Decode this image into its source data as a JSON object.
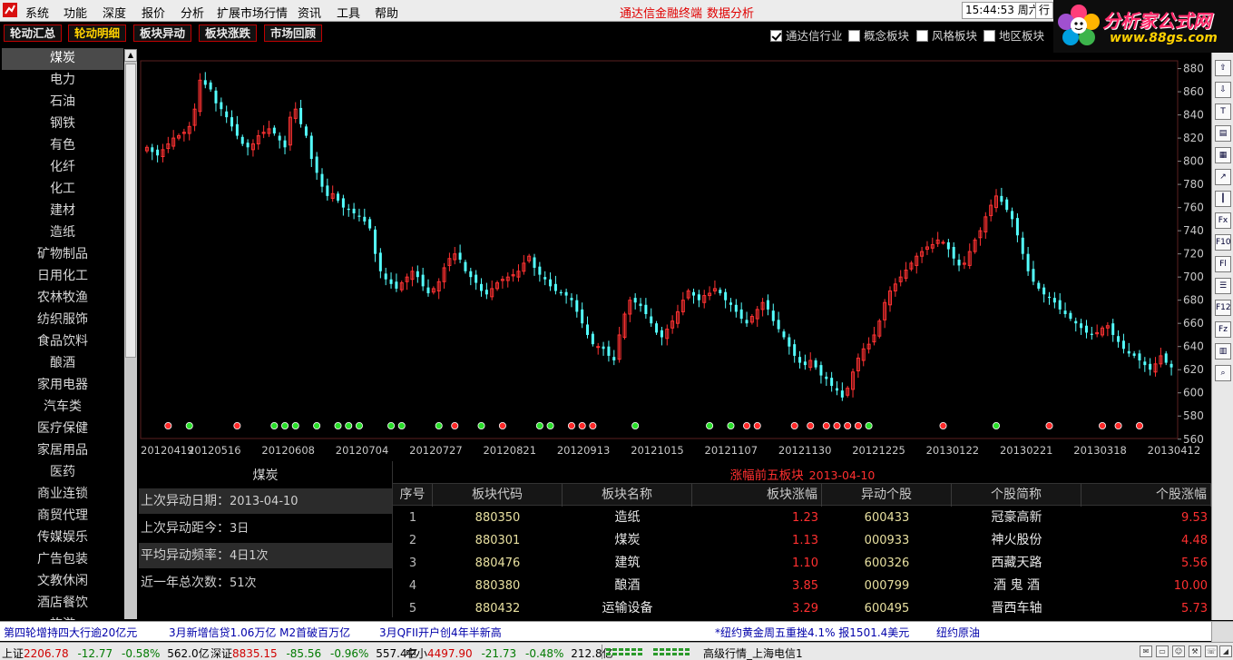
{
  "menu": {
    "items": [
      "系统",
      "功能",
      "深度",
      "报价",
      "分析",
      "扩展市场行情",
      "资讯",
      "工具",
      "帮助"
    ],
    "title_links": [
      "通达信金融终端",
      "数据分析"
    ],
    "clock": "15:44:53 周六",
    "extra": "行"
  },
  "logo": {
    "title": "分析家公式网",
    "url": "www.88gs.com"
  },
  "tabs": [
    {
      "label": "轮动汇总",
      "active": false
    },
    {
      "label": "轮动明细",
      "active": true
    },
    {
      "label": "板块异动",
      "active": false
    },
    {
      "label": "板块涨跌",
      "active": false
    },
    {
      "label": "市场回顾",
      "active": false
    }
  ],
  "filters": [
    {
      "label": "通达信行业",
      "checked": true
    },
    {
      "label": "概念板块",
      "checked": false
    },
    {
      "label": "风格板块",
      "checked": false
    },
    {
      "label": "地区板块",
      "checked": false
    }
  ],
  "sidebar": {
    "selected": "煤炭",
    "items": [
      "煤炭",
      "电力",
      "石油",
      "钢铁",
      "有色",
      "化纤",
      "化工",
      "建材",
      "造纸",
      "矿物制品",
      "日用化工",
      "农林牧渔",
      "纺织服饰",
      "食品饮料",
      "酿酒",
      "家用电器",
      "汽车类",
      "医疗保健",
      "家居用品",
      "医药",
      "商业连锁",
      "商贸代理",
      "传媒娱乐",
      "广告包装",
      "文教休闲",
      "酒店餐饮",
      "旅游"
    ]
  },
  "chart_data": {
    "type": "candlestick",
    "ylim": [
      570,
      882
    ],
    "yticks": [
      880,
      860,
      840,
      820,
      800,
      780,
      760,
      740,
      720,
      700,
      680,
      660,
      640,
      620,
      600,
      580,
      560
    ],
    "x_labels": [
      "20120419",
      "20120516",
      "20120608",
      "20120704",
      "20120727",
      "20120821",
      "20120913",
      "20121015",
      "20121107",
      "20121130",
      "20121225",
      "20130122",
      "20130221",
      "20130318",
      "20130412"
    ],
    "close_series": [
      812,
      808,
      805,
      810,
      815,
      820,
      822,
      825,
      830,
      845,
      870,
      866,
      862,
      850,
      845,
      838,
      830,
      822,
      815,
      812,
      815,
      822,
      825,
      828,
      824,
      818,
      812,
      838,
      845,
      832,
      822,
      802,
      790,
      778,
      770,
      772,
      766,
      760,
      758,
      755,
      752,
      748,
      742,
      720,
      705,
      698,
      694,
      690,
      695,
      700,
      705,
      700,
      692,
      686,
      690,
      696,
      708,
      716,
      720,
      715,
      705,
      700,
      695,
      688,
      685,
      690,
      695,
      698,
      700,
      702,
      705,
      712,
      718,
      708,
      702,
      698,
      692,
      688,
      686,
      684,
      680,
      670,
      660,
      650,
      642,
      640,
      638,
      632,
      628,
      650,
      668,
      680,
      678,
      675,
      668,
      660,
      652,
      648,
      655,
      662,
      670,
      680,
      688,
      684,
      680,
      684,
      686,
      690,
      686,
      680,
      676,
      670,
      664,
      660,
      666,
      672,
      678,
      672,
      662,
      655,
      648,
      640,
      632,
      626,
      624,
      628,
      622,
      615,
      612,
      606,
      602,
      596,
      604,
      618,
      630,
      638,
      642,
      650,
      662,
      678,
      688,
      694,
      700,
      706,
      712,
      718,
      722,
      726,
      728,
      732,
      730,
      724,
      716,
      710,
      712,
      722,
      732,
      740,
      752,
      762,
      770,
      765,
      758,
      750,
      736,
      720,
      705,
      696,
      690,
      685,
      682,
      678,
      672,
      668,
      664,
      660,
      656,
      652,
      650,
      652,
      656,
      658,
      650,
      644,
      638,
      634,
      632,
      628,
      624,
      620,
      625,
      632,
      626,
      622
    ],
    "signals": [
      {
        "date_index": 4,
        "type": "red"
      },
      {
        "date_index": 8,
        "type": "green"
      },
      {
        "date_index": 17,
        "type": "red"
      },
      {
        "date_index": 24,
        "type": "green"
      },
      {
        "date_index": 26,
        "type": "green"
      },
      {
        "date_index": 28,
        "type": "green"
      },
      {
        "date_index": 32,
        "type": "green"
      },
      {
        "date_index": 36,
        "type": "green"
      },
      {
        "date_index": 38,
        "type": "green"
      },
      {
        "date_index": 40,
        "type": "green"
      },
      {
        "date_index": 46,
        "type": "green"
      },
      {
        "date_index": 48,
        "type": "green"
      },
      {
        "date_index": 55,
        "type": "green"
      },
      {
        "date_index": 58,
        "type": "red"
      },
      {
        "date_index": 63,
        "type": "green"
      },
      {
        "date_index": 67,
        "type": "red"
      },
      {
        "date_index": 74,
        "type": "green"
      },
      {
        "date_index": 76,
        "type": "green"
      },
      {
        "date_index": 80,
        "type": "red"
      },
      {
        "date_index": 82,
        "type": "red"
      },
      {
        "date_index": 84,
        "type": "red"
      },
      {
        "date_index": 92,
        "type": "green"
      },
      {
        "date_index": 106,
        "type": "green"
      },
      {
        "date_index": 110,
        "type": "green"
      },
      {
        "date_index": 113,
        "type": "red"
      },
      {
        "date_index": 115,
        "type": "red"
      },
      {
        "date_index": 122,
        "type": "red"
      },
      {
        "date_index": 125,
        "type": "red"
      },
      {
        "date_index": 128,
        "type": "red"
      },
      {
        "date_index": 130,
        "type": "red"
      },
      {
        "date_index": 132,
        "type": "red"
      },
      {
        "date_index": 134,
        "type": "red"
      },
      {
        "date_index": 136,
        "type": "green"
      },
      {
        "date_index": 150,
        "type": "red"
      },
      {
        "date_index": 160,
        "type": "green"
      },
      {
        "date_index": 170,
        "type": "red"
      },
      {
        "date_index": 180,
        "type": "red"
      },
      {
        "date_index": 183,
        "type": "red"
      },
      {
        "date_index": 187,
        "type": "red"
      },
      {
        "date_index": 200,
        "type": "green"
      },
      {
        "date_index": 201,
        "type": "green"
      },
      {
        "date_index": 202,
        "type": "green"
      },
      {
        "date_index": 211,
        "type": "green"
      },
      {
        "date_index": 218,
        "type": "red"
      },
      {
        "date_index": 219,
        "type": "green"
      },
      {
        "date_index": 221,
        "type": "red"
      },
      {
        "date_index": 222,
        "type": "green"
      },
      {
        "date_index": 223,
        "type": "green"
      },
      {
        "date_index": 224,
        "type": "green"
      },
      {
        "date_index": 230,
        "type": "green"
      },
      {
        "date_index": 232,
        "type": "red"
      },
      {
        "date_index": 234,
        "type": "green"
      },
      {
        "date_index": 236,
        "type": "green"
      },
      {
        "date_index": 238,
        "type": "red"
      },
      {
        "date_index": 240,
        "type": "green"
      },
      {
        "date_index": 255,
        "type": "red"
      }
    ]
  },
  "info": {
    "sector_name": "煤炭",
    "rows": [
      {
        "label": "上次异动日期：",
        "value": "2013-04-10"
      },
      {
        "label": "上次异动距今：",
        "value": "3日"
      },
      {
        "label": "平均异动频率：",
        "value": "4日1次"
      },
      {
        "label": "近一年总次数：",
        "value": "51次"
      }
    ]
  },
  "top5": {
    "title": "涨幅前五板块",
    "date": "2013-04-10",
    "headers": [
      "序号",
      "板块代码",
      "板块名称",
      "板块涨幅",
      "异动个股",
      "个股简称",
      "个股涨幅"
    ],
    "rows": [
      [
        "1",
        "880350",
        "造纸",
        "1.23",
        "600433",
        "冠豪高新",
        "9.53"
      ],
      [
        "2",
        "880301",
        "煤炭",
        "1.13",
        "000933",
        "神火股份",
        "4.48"
      ],
      [
        "3",
        "880476",
        "建筑",
        "1.10",
        "600326",
        "西藏天路",
        "5.56"
      ],
      [
        "4",
        "880380",
        "酿酒",
        "3.85",
        "000799",
        "酒 鬼 酒",
        "10.00"
      ],
      [
        "5",
        "880432",
        "运输设备",
        "3.29",
        "600495",
        "晋西车轴",
        "5.73"
      ]
    ]
  },
  "toolbar_icons": [
    "arrow-up",
    "arrow-down",
    "text",
    "table",
    "grid",
    "trend",
    "kline",
    "Fx",
    "F10",
    "Fl",
    "list",
    "F12",
    "Fz",
    "calendar",
    "zoom"
  ],
  "news": [
    "第四轮增持四大行逾20亿元",
    "3月新增信贷1.06万亿  M2首破百万亿",
    "3月QFII开户创4年半新高",
    "*纽约黄金周五重挫4.1% 报1501.4美元",
    "纽约原油"
  ],
  "status": {
    "sh": {
      "name": "上证",
      "value": "2206.78",
      "change": "-12.77",
      "pct": "-0.58%",
      "amount": "562.0亿"
    },
    "sz": {
      "name": "深证",
      "value": "8835.15",
      "change": "-85.56",
      "pct": "-0.96%",
      "amount": "557.4亿"
    },
    "zx": {
      "name": "中小",
      "value": "4497.90",
      "change": "-21.73",
      "pct": "-0.48%",
      "amount": "212.8亿"
    },
    "connection": "高级行情_上海电信1"
  }
}
